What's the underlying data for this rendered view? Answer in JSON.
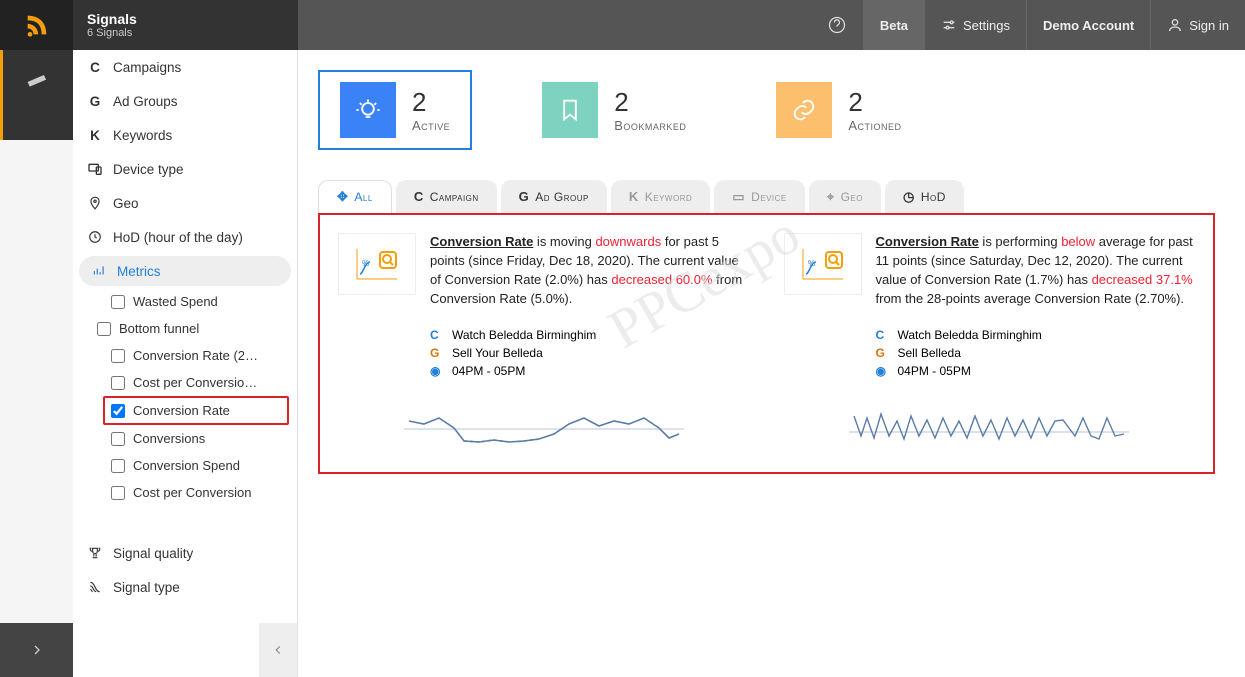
{
  "header": {
    "title": "Signals",
    "subtitle": "6 Signals",
    "beta": "Beta",
    "settings": "Settings",
    "account": "Demo Account",
    "signin": "Sign in"
  },
  "sidebar": {
    "campaigns": "Campaigns",
    "adgroups": "Ad Groups",
    "keywords": "Keywords",
    "device": "Device type",
    "geo": "Geo",
    "hod": "HoD (hour of the day)",
    "metrics": "Metrics",
    "wasted": "Wasted Spend",
    "bottom": "Bottom funnel",
    "cr2": "Conversion Rate (2…",
    "cpc": "Cost per Conversio…",
    "convrate": "Conversion Rate",
    "convs": "Conversions",
    "convspend": "Conversion Spend",
    "cpconv": "Cost per Conversion",
    "sigq": "Signal quality",
    "sigt": "Signal type"
  },
  "stats": {
    "active_n": "2",
    "active_l": "Active",
    "book_n": "2",
    "book_l": "Bookmarked",
    "act_n": "2",
    "act_l": "Actioned"
  },
  "tabs": {
    "all": "All",
    "camp": "Campaign",
    "adg": "Ad Group",
    "kw": "Keyword",
    "dev": "Device",
    "geo": "Geo",
    "hod": "HoD"
  },
  "card1": {
    "metric": "Conversion Rate",
    "verb": " is moving ",
    "dir": "downwards",
    "rest1": " for past 5 points (since Friday, Dec 18, 2020). The current value of Conversion Rate (2.0%) has ",
    "dec": "decreased 60.0%",
    "rest2": " from Conversion Rate (5.0%).",
    "camp": "Watch Beledda Birminghim",
    "adg": "Sell Your Belleda",
    "time": "04PM - 05PM"
  },
  "card2": {
    "metric": "Conversion Rate",
    "verb": " is performing ",
    "dir": "below",
    "rest1": " average for past 11 points (since Saturday, Dec 12, 2020). The current value of Conversion Rate (1.7%) has ",
    "dec": "decreased 37.1%",
    "rest2": " from the 28-points average Conversion Rate (2.70%).",
    "camp": "Watch Beledda Birminghim",
    "adg": "Sell Belleda",
    "time": "04PM - 05PM"
  },
  "watermark": "PPCexpo"
}
